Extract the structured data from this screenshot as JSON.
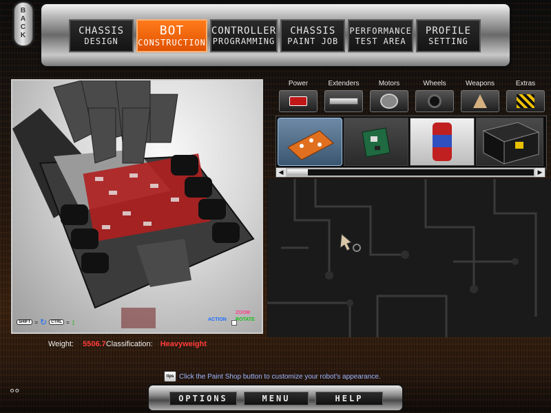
{
  "nav": {
    "back_label": "BACK",
    "tabs": [
      {
        "line1": "CHASSIS",
        "line2": "DESIGN",
        "active": false
      },
      {
        "line1": "BOT",
        "line2": "CONSTRUCTION",
        "active": true
      },
      {
        "line1": "CONTROLLER",
        "line2": "PROGRAMMING",
        "active": false
      },
      {
        "line1": "CHASSIS",
        "line2": "PAINT JOB",
        "active": false
      },
      {
        "line1": "PERFORMANCE",
        "line2": "TEST AREA",
        "active": false
      },
      {
        "line1": "PROFILE",
        "line2": "SETTING",
        "active": false
      }
    ]
  },
  "viewport": {
    "shift_key": "SHIFT",
    "ctrl_key": "CTRL",
    "action_label": "ACTION",
    "zoom_label": "ZOOM",
    "rotate_label": "ROTATE"
  },
  "parts": {
    "categories": [
      {
        "label": "Power",
        "icon": "battery-icon"
      },
      {
        "label": "Extenders",
        "icon": "extender-bar-icon"
      },
      {
        "label": "Motors",
        "icon": "motor-icon"
      },
      {
        "label": "Wheels",
        "icon": "wheel-icon"
      },
      {
        "label": "Weapons",
        "icon": "weapon-icon"
      },
      {
        "label": "Extras",
        "icon": "hazard-stripe-icon"
      }
    ],
    "items": [
      {
        "icon": "orange-battery-pack-icon",
        "selected": true
      },
      {
        "icon": "circuit-board-icon",
        "selected": false
      },
      {
        "icon": "canister-battery-icon",
        "selected": false
      },
      {
        "icon": "power-box-icon",
        "selected": false
      }
    ]
  },
  "stats": {
    "weight_label": "Weight:",
    "weight_value": "5506.7",
    "class_label": "Classification:",
    "class_value": "Heavyweight"
  },
  "tip": {
    "icon_label": "tips",
    "text": "Click the Paint Shop button to customize your robot's appearance."
  },
  "bottom": {
    "options_label": "OPTIONS",
    "menu_label": "MENU",
    "help_label": "HELP"
  },
  "colors": {
    "accent_orange": "#e05200",
    "stat_red": "#ff3b3b",
    "tip_blue": "#9fb7ff"
  }
}
